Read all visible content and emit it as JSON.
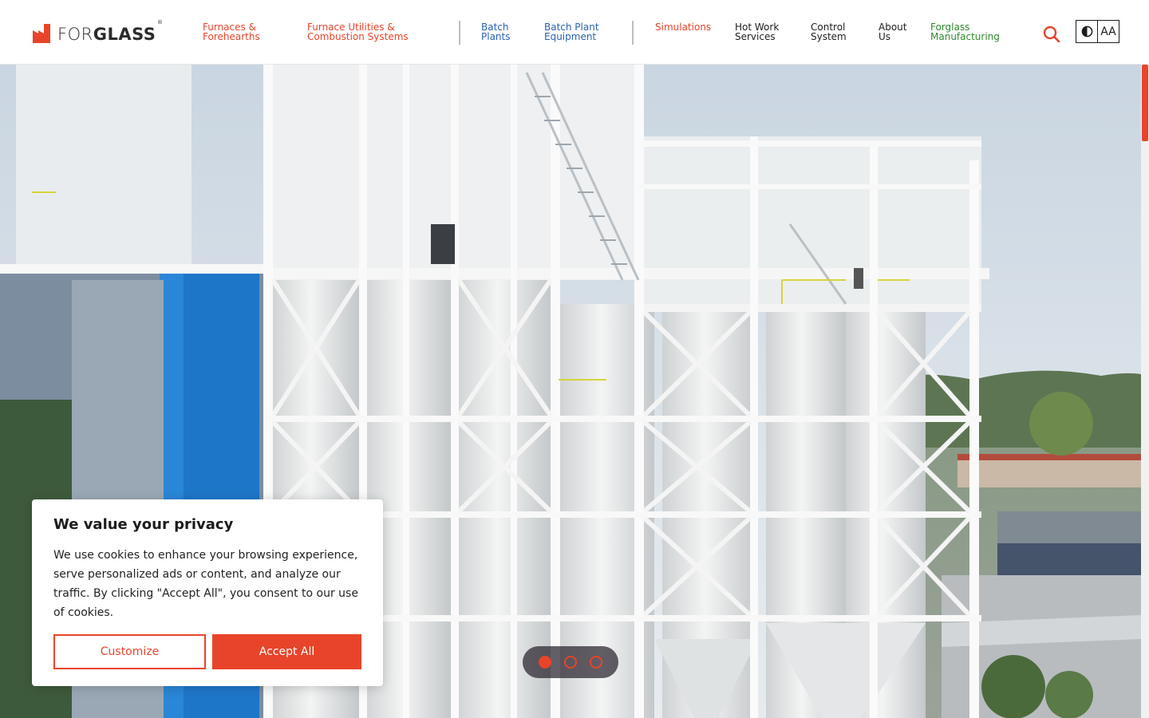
{
  "brand": {
    "logo_light": "FOR",
    "logo_bold": "GLASS",
    "registered": "®",
    "accent_color": "#e8442a"
  },
  "nav": {
    "furnaces": [
      "Furnaces &",
      "Forehearths"
    ],
    "utilities": [
      "Furnace Utilities &",
      "Combustion Systems"
    ],
    "batch_plants": [
      "Batch",
      "Plants"
    ],
    "batch_equipment": [
      "Batch Plant",
      "Equipment"
    ],
    "simulations": "Simulations",
    "hot_work": [
      "Hot Work",
      "Services"
    ],
    "control": [
      "Control",
      "System"
    ],
    "about": [
      "About",
      "Us"
    ],
    "manufacturing": [
      "Forglass",
      "Manufacturing"
    ]
  },
  "tools": {
    "contrast_icon": "contrast-icon",
    "font_size_label": "AA",
    "search_icon": "search-icon"
  },
  "hero": {
    "slides_total": 3,
    "active_slide": 1
  },
  "cookie": {
    "title": "We value your privacy",
    "text": "We use cookies to enhance your browsing experience, serve personalized ads or content, and analyze our traffic. By clicking \"Accept All\", you consent to our use of cookies.",
    "customize_label": "Customize",
    "accept_label": "Accept All"
  }
}
